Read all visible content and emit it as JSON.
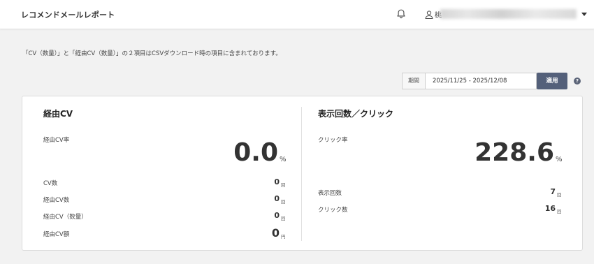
{
  "header": {
    "title": "レコメンドメールレポート",
    "user_initial": "桃"
  },
  "notice": "「CV（数量）」と「経由CV（数量）」の２項目はCSVダウンロード時の項目に含まれております。",
  "period": {
    "label": "期間",
    "value": "2025/11/25 - 2025/12/08",
    "apply_label": "適用",
    "help_label": "?"
  },
  "left": {
    "title": "経由CV",
    "rate_label": "経由CV率",
    "rate_value": "0.0",
    "rate_unit": "%",
    "rows": [
      {
        "label": "CV数",
        "value": "0",
        "unit": "回"
      },
      {
        "label": "経由CV数",
        "value": "0",
        "unit": "回"
      },
      {
        "label": "経由CV（数量）",
        "value": "0",
        "unit": "回"
      },
      {
        "label": "経由CV額",
        "value": "0",
        "unit": "円"
      }
    ]
  },
  "right": {
    "title": "表示回数／クリック",
    "rate_label": "クリック率",
    "rate_value": "228.6",
    "rate_unit": "%",
    "rows": [
      {
        "label": "表示回数",
        "value": "7",
        "unit": "回"
      },
      {
        "label": "クリック数",
        "value": "16",
        "unit": "回"
      }
    ]
  },
  "colors": {
    "apply_button": "#54607a",
    "background": "#f2f2f2"
  },
  "icons": [
    "bell-icon",
    "user-icon",
    "caret-down-icon",
    "help-icon"
  ]
}
